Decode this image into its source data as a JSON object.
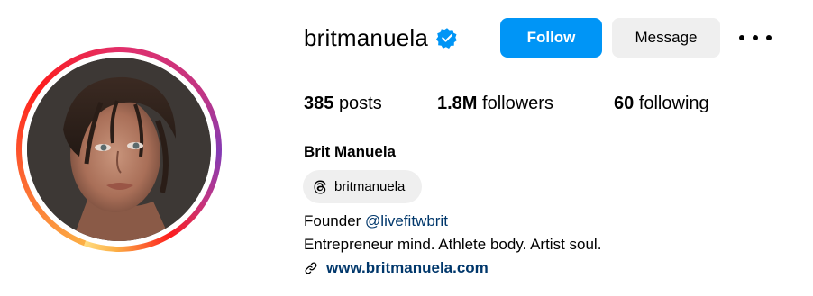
{
  "profile": {
    "username": "britmanuela",
    "full_name": "Brit Manuela",
    "verified": true,
    "threads_handle": "britmanuela",
    "bio_prefix": "Founder ",
    "bio_mention": "@livefitwbrit",
    "bio_line2": "Entrepreneur mind. Athlete body. Artist soul.",
    "website": "www.britmanuela.com"
  },
  "stats": {
    "posts_count": "385",
    "posts_label": "posts",
    "followers_count": "1.8M",
    "followers_label": "followers",
    "following_count": "60",
    "following_label": "following"
  },
  "actions": {
    "follow_label": "Follow",
    "message_label": "Message"
  },
  "icons": {
    "verified": "verified-badge-icon",
    "more": "more-options-icon",
    "threads": "threads-icon",
    "link": "link-icon"
  },
  "colors": {
    "primary_button": "#0095f6",
    "secondary_button": "#efefef",
    "link_text": "#00376b",
    "verified_badge": "#0095f6"
  }
}
